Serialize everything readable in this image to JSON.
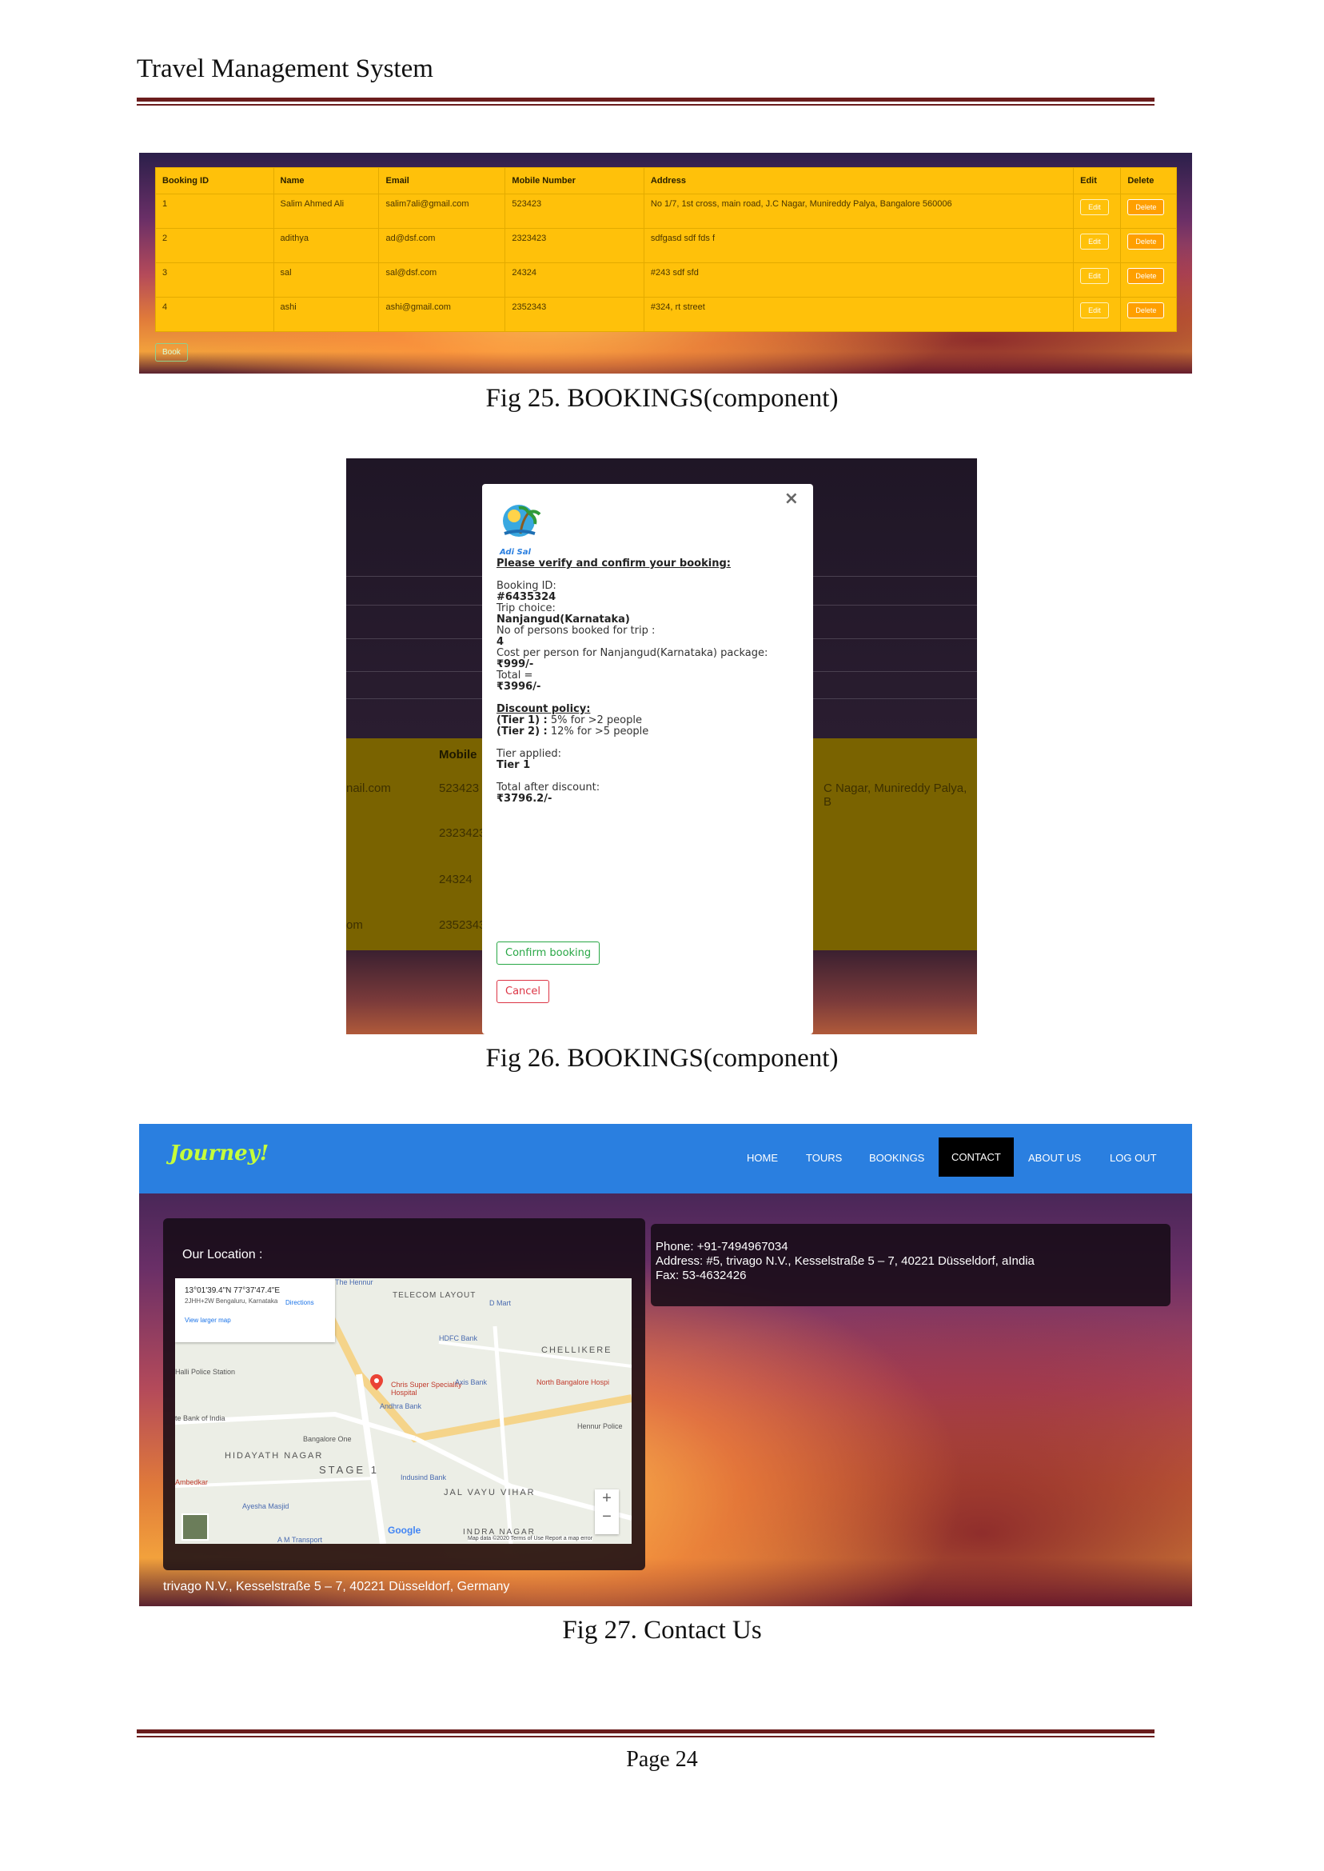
{
  "header": {
    "title": "Travel Management System"
  },
  "fig25": {
    "caption": "Fig 25. BOOKINGS(component)",
    "columns": [
      "Booking ID",
      "Name",
      "Email",
      "Mobile Number",
      "Address",
      "Edit",
      "Delete"
    ],
    "rows": [
      [
        "1",
        "Salim Ahmed Ali",
        "salim7ali@gmail.com",
        "523423",
        "No 1/7, 1st cross, main road, J.C Nagar, Munireddy Palya, Bangalore 560006"
      ],
      [
        "2",
        "adithya",
        "ad@dsf.com",
        "2323423",
        "sdfgasd sdf fds f"
      ],
      [
        "3",
        "sal",
        "sal@dsf.com",
        "24324",
        "#243 sdf sfd"
      ],
      [
        "4",
        "ashi",
        "ashi@gmail.com",
        "2352343",
        "#324, rt street"
      ]
    ],
    "edit_label": "Edit",
    "delete_label": "Delete",
    "book_label": "Book"
  },
  "fig26": {
    "caption": "Fig 26. BOOKINGS(component)",
    "background": {
      "col_header": "Mobile",
      "email_fragment_1": "nail.com",
      "email_fragment_4": "om",
      "mobile_1": "523423",
      "mobile_2": "2323423",
      "mobile_3": "24324",
      "mobile_4": "2352343",
      "address_fragment": "C Nagar, Munireddy Palya, B"
    },
    "modal": {
      "close": "×",
      "logo_text": "Adi Sal",
      "heading": "Please verify and confirm your booking:",
      "booking_id_label": "Booking ID:",
      "booking_id": "#6435324",
      "trip_label": "Trip choice:",
      "trip": "Nanjangud(Karnataka)",
      "persons_label": "No of persons booked for trip :",
      "persons": "4",
      "cost_label": "Cost per person for Nanjangud(Karnataka) package:",
      "cost": "₹999/-",
      "total_label": "Total =",
      "total": "₹3996/-",
      "policy_heading": "Discount policy:",
      "tier1_label": "(Tier 1) :",
      "tier1_text": " 5% for >2 people",
      "tier2_label": "(Tier 2) :",
      "tier2_text": " 12% for >5 people",
      "tier_applied_label": "Tier applied:",
      "tier_applied": "Tier 1",
      "after_discount_label": "Total after discount:",
      "after_discount": "₹3796.2/-",
      "confirm_label": "Confirm booking",
      "cancel_label": "Cancel"
    }
  },
  "fig27": {
    "caption": "Fig 27. Contact Us",
    "brand": "Journey!",
    "nav": [
      "HOME",
      "TOURS",
      "BOOKINGS",
      "CONTACT",
      "ABOUT US",
      "LOG OUT"
    ],
    "location_title": "Our Location :",
    "map": {
      "coords": "13°01'39.4\"N 77°37'47.4\"E",
      "plus_code": "2JHH+2W Bengaluru, Karnataka",
      "directions": "Directions",
      "larger_map": "View larger map",
      "labels": [
        "TELECOM LAYOUT",
        "HDFC Bank",
        "CHELLIKERE",
        "North Bangalore Hospi",
        "Chris Super Speciality Hospital",
        "Axis Bank",
        "Andhra Bank",
        "HIDAYATH NAGAR",
        "STAGE 1",
        "Indusind Bank",
        "JAL VAYU VIHAR",
        "Ayesha Masjid",
        "INDRA NAGAR",
        "Bangalore One",
        "Halli Police Station",
        "te Bank of India",
        "Ambedkar",
        "A M Transport",
        "Hennur Police",
        "D Mart",
        "The Hennur"
      ],
      "attribution": "Map data ©2020  Terms of Use  Report a map error",
      "google": "Google",
      "zoom_in": "+",
      "zoom_out": "−"
    },
    "phone": "Phone: +91-7494967034",
    "address": "Address: #5, trivago N.V., Kesselstraße 5 – 7, 40221 Düsseldorf, aIndia",
    "fax": "Fax: 53-4632426",
    "footer_address": "trivago N.V., Kesselstraße 5 – 7, 40221 Düsseldorf, Germany"
  },
  "footer": {
    "page": "Page 24"
  },
  "colors": {
    "rule": "#6b1d1d",
    "table_yellow": "#ffc10a",
    "nav_blue": "#2a7fe0",
    "confirm_green": "#28a745",
    "cancel_red": "#dc3545"
  }
}
